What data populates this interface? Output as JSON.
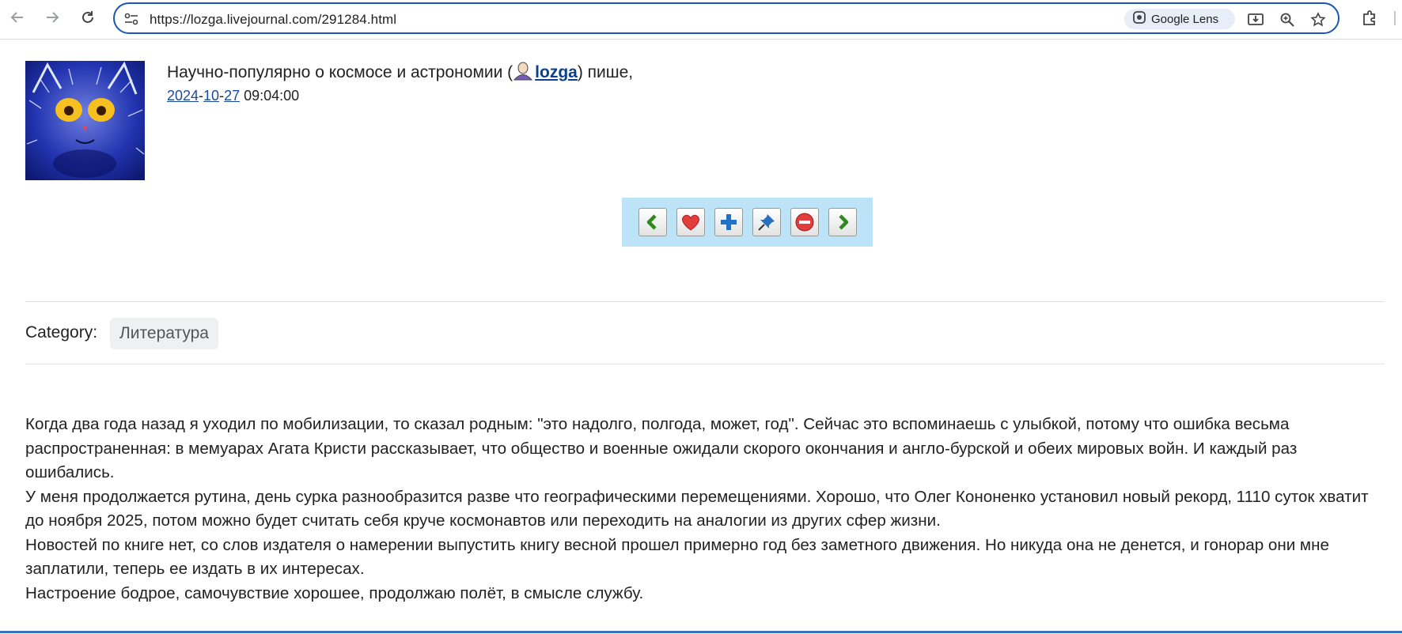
{
  "browser": {
    "url": "https://lozga.livejournal.com/291284.html",
    "lens_label": "Google Lens",
    "icons": [
      "back-arrow-icon",
      "forward-arrow-icon",
      "reload-icon",
      "site-info-icon",
      "google-lens-icon",
      "install-app-icon",
      "zoom-icon",
      "bookmark-star-icon",
      "extensions-icon"
    ]
  },
  "post": {
    "journal_title": "Научно-популярно о космосе и астрономии (",
    "username": "lozga",
    "after_user": ") пише,",
    "date": {
      "year": "2024",
      "month": "10",
      "day": "27",
      "time": "09:04:00"
    },
    "actions": [
      "previous-entry",
      "add-to-memories",
      "add-friend",
      "tell-a-friend",
      "flag",
      "next-entry"
    ],
    "category_label": "Category:",
    "category_tag": "Литература",
    "paragraphs": [
      "Когда два года назад я уходил по мобилизации, то сказал родным: \"это надолго, полгода, может, год\". Сейчас это вспоминаешь с улыбкой, потому что ошибка весьма распространенная: в мемуарах Агата Кристи рассказывает, что общество и военные ожидали скорого окончания и англо-бурской и обеих мировых войн. И каждый раз ошибались.",
      "У меня продолжается рутина, день сурка разнообразится разве что географическими перемещениями. Хорошо, что Олег Кононенко установил новый рекорд, 1110 суток хватит до ноября 2025, потом можно будет считать себя круче космонавтов или переходить на аналогии из других сфер жизни.",
      "Новостей по книге нет, со слов издателя о намерении выпустить книгу весной прошел примерно год без заметного движения. Но никуда она не денется, и гонорар они мне заплатили, теперь ее издать в их интересах.",
      "Настроение бодрое, самочувствие хорошее, продолжаю полёт, в смысле службу."
    ]
  },
  "colors": {
    "link": "#1a4a9e",
    "actionbar": "#bde3f8",
    "omnibox_border": "#1a56b8"
  }
}
